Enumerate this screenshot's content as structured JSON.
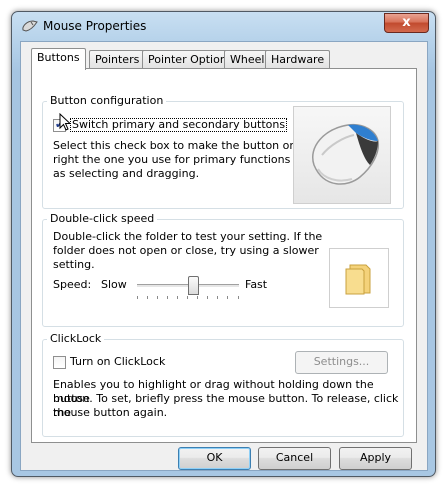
{
  "window": {
    "title": "Mouse Properties",
    "close_glyph": "x"
  },
  "tabs": [
    {
      "label": "Buttons",
      "active": true
    },
    {
      "label": "Pointers",
      "active": false
    },
    {
      "label": "Pointer Options",
      "active": false
    },
    {
      "label": "Wheel",
      "active": false
    },
    {
      "label": "Hardware",
      "active": false
    }
  ],
  "button_configuration": {
    "legend": "Button configuration",
    "switch_label": "Switch primary and secondary buttons",
    "switch_checked": true,
    "description_line1": "Select this check box to make the button on the",
    "description_line2": "right the one you use for primary functions such",
    "description_line3": "as selecting and dragging."
  },
  "double_click": {
    "legend": "Double-click speed",
    "description_line1": "Double-click the folder to test your setting. If the",
    "description_line2": "folder does not open or close, try using a slower",
    "description_line3": "setting.",
    "speed_label": "Speed:",
    "slow_label": "Slow",
    "fast_label": "Fast",
    "speed_level": 0.55
  },
  "clicklock": {
    "legend": "ClickLock",
    "checkbox_label": "Turn on ClickLock",
    "checked": false,
    "settings_button": "Settings...",
    "description_line1": "Enables you to highlight or drag without holding down the mouse",
    "description_line2": "button. To set, briefly press the mouse button. To release, click the",
    "description_line3": "mouse button again."
  },
  "footer": {
    "ok": "OK",
    "cancel": "Cancel",
    "apply": "Apply"
  }
}
